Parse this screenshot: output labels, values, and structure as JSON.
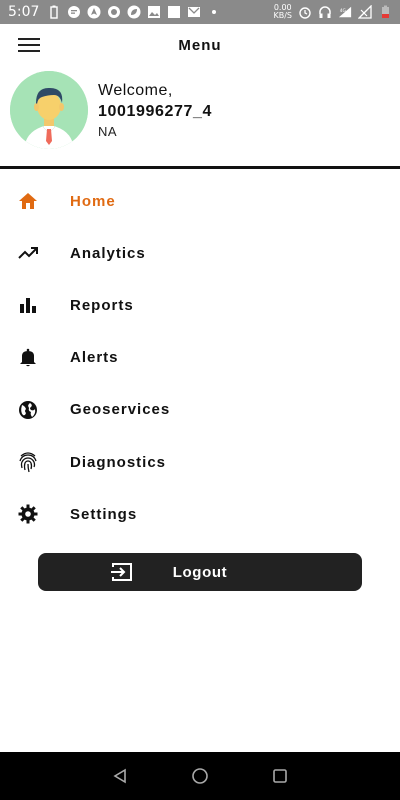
{
  "status_bar": {
    "time": "5:07",
    "net_speed_value": "0.00",
    "net_speed_unit": "KB/S",
    "network_label": "4G"
  },
  "header": {
    "title": "Menu"
  },
  "profile": {
    "welcome": "Welcome,",
    "user_id": "1001996277_4",
    "subtitle": "NA"
  },
  "menu": {
    "items": [
      {
        "label": "Home",
        "icon": "home-icon",
        "active": true
      },
      {
        "label": "Analytics",
        "icon": "trending-up-icon"
      },
      {
        "label": "Reports",
        "icon": "bar-chart-icon"
      },
      {
        "label": "Alerts",
        "icon": "bell-icon"
      },
      {
        "label": "Geoservices",
        "icon": "globe-icon"
      },
      {
        "label": "Diagnostics",
        "icon": "fingerprint-icon"
      },
      {
        "label": "Settings",
        "icon": "gear-icon"
      }
    ]
  },
  "logout": {
    "label": "Logout",
    "icon": "logout-icon"
  },
  "colors": {
    "accent": "#e06a12",
    "dark": "#222222"
  }
}
